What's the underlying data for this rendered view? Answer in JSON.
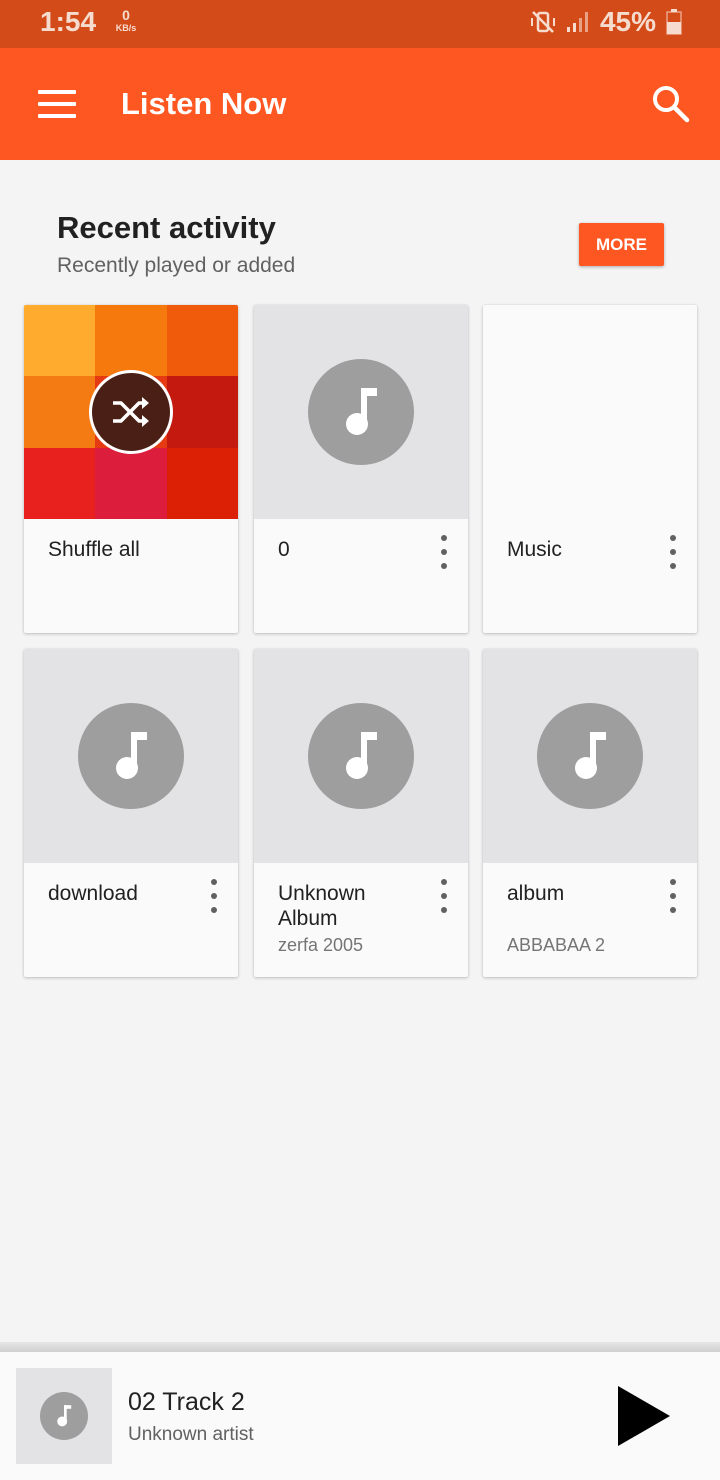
{
  "status_bar": {
    "time": "1:54",
    "network_speed": "0",
    "network_unit": "KB/s",
    "battery": "45%",
    "icons": [
      "mute-vibrate-icon",
      "signal-icon",
      "battery-icon"
    ]
  },
  "app_bar": {
    "title": "Listen Now",
    "menu_icon": "hamburger-menu-icon",
    "search_icon": "search-icon",
    "color": "#ff5722"
  },
  "recent_activity": {
    "title": "Recent activity",
    "subtitle": "Recently played or added",
    "more_label": "MORE",
    "cards": [
      {
        "title": "Shuffle all",
        "subtitle": "",
        "art": "shuffle-mosaic",
        "has_menu": false
      },
      {
        "title": "0",
        "subtitle": "",
        "art": "music-note",
        "has_menu": true
      },
      {
        "title": "Music",
        "subtitle": "",
        "art": "empty",
        "has_menu": true
      },
      {
        "title": "download",
        "subtitle": "",
        "art": "music-note",
        "has_menu": true
      },
      {
        "title": "Unknown Album",
        "subtitle": "zerfa 2005",
        "art": "music-note",
        "has_menu": true
      },
      {
        "title": "album",
        "subtitle": "ABBABAA 2",
        "art": "music-note",
        "has_menu": true
      }
    ],
    "mosaic_colors": [
      "#ffab2e",
      "#f5790c",
      "#f05a0b",
      "#f47b14",
      "#e53a12",
      "#c4190e",
      "#e8211e",
      "#dc1d3c",
      "#db2006"
    ]
  },
  "now_playing": {
    "title": "02 Track 2",
    "artist": "Unknown artist",
    "play_icon": "play-icon"
  }
}
